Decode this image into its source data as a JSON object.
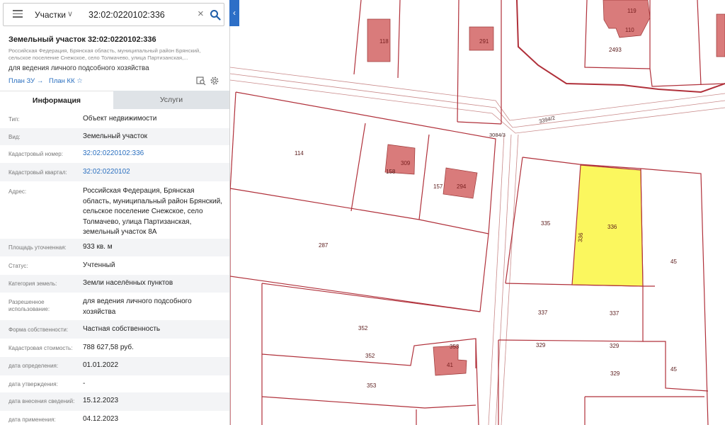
{
  "search": {
    "layer": "Участки",
    "query": "32:02:0220102:336"
  },
  "card": {
    "title": "Земельный участок 32:02:0220102:336",
    "address_short": "Российская Федерация, Брянская область, муниципальный район Брянский, сельское поселение Снежское, село Толмачево, улица Партизанская,...",
    "use": "для ведения личного подсобного хозяйства",
    "plan_zu": "План ЗУ",
    "plan_kk": "План КК"
  },
  "tabs": {
    "info": "Информация",
    "services": "Услуги"
  },
  "info": {
    "type_l": "Тип:",
    "type_v": "Объект недвижимости",
    "kind_l": "Вид:",
    "kind_v": "Земельный участок",
    "cadnum_l": "Кадастровый номер:",
    "cadnum_v": "32:02:0220102:336",
    "quarter_l": "Кадастровый квартал:",
    "quarter_v": "32:02:0220102",
    "address_l": "Адрес:",
    "address_v": "Российская Федерация, Брянская область, муниципальный район Брянский, сельское поселение Снежское, село Толмачево, улица Партизанская, земельный участок 8А",
    "area_l": "Площадь уточненная:",
    "area_v": "933 кв. м",
    "status_l": "Статус:",
    "status_v": "Учтенный",
    "category_l": "Категория земель:",
    "category_v": "Земли населённых пунктов",
    "permitted_l": "Разрешенное использование:",
    "permitted_v": "для ведения личного подсобного хозяйства",
    "ownership_l": "Форма собственности:",
    "ownership_v": "Частная собственность",
    "cost_l": "Кадастровая стоимость:",
    "cost_v": "788 627,58 руб.",
    "det_date_l": "дата определения:",
    "det_date_v": "01.01.2022",
    "appr_date_l": "дата утверждения:",
    "appr_date_v": "-",
    "entry_date_l": "дата внесения сведений:",
    "entry_date_v": "15.12.2023",
    "apply_date_l": "дата применения:",
    "apply_date_v": "04.12.2023"
  },
  "map": {
    "parcels": {
      "p114": "114",
      "p158": "158",
      "p157": "157",
      "p287": "287",
      "p335": "335",
      "p336": "336",
      "p336_side": "336",
      "p45a": "45",
      "p45b": "45",
      "p337a": "337",
      "p337b": "337",
      "p329a": "329",
      "p329b": "329",
      "p329c": "329",
      "p352a": "352",
      "p352b": "352",
      "p353a": "353",
      "p353b": "353",
      "p2493": "2493",
      "street1": "3084/3",
      "street2": "3394/2"
    },
    "buildings": {
      "b118": "118",
      "b291": "291",
      "b119": "119",
      "b110": "110",
      "b309": "309",
      "b294": "294",
      "b41": "41"
    },
    "colors": {
      "boundary": "#b0303a",
      "building_fill": "#d97b7b",
      "selected_fill": "#fbf75e"
    }
  }
}
